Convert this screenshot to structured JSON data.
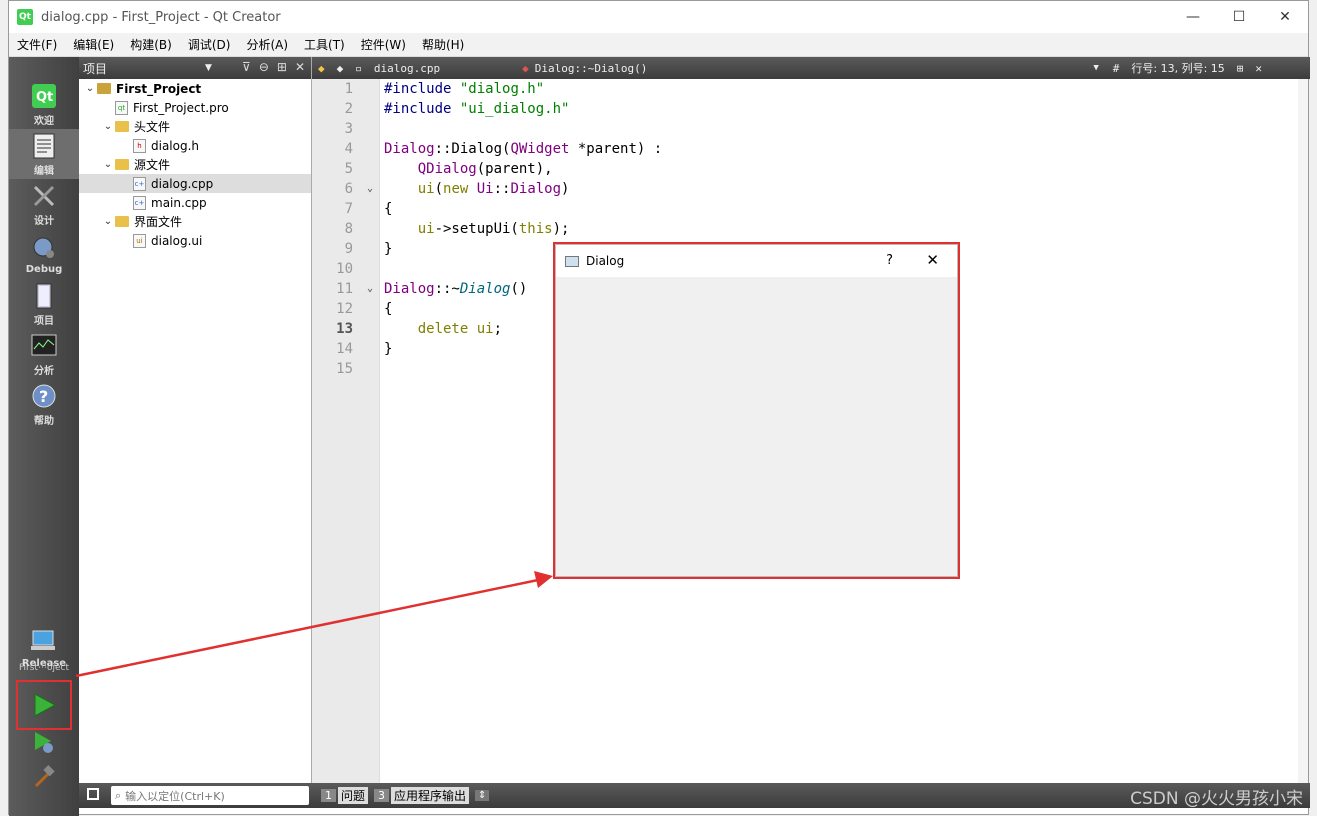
{
  "window": {
    "title": "dialog.cpp - First_Project - Qt Creator",
    "controls": [
      "minimize",
      "maximize",
      "close"
    ]
  },
  "menu": [
    "文件(F)",
    "编辑(E)",
    "构建(B)",
    "调试(D)",
    "分析(A)",
    "工具(T)",
    "控件(W)",
    "帮助(H)"
  ],
  "modes": [
    {
      "label": "欢迎",
      "icon": "qt-logo-icon",
      "active": false
    },
    {
      "label": "编辑",
      "icon": "edit-icon",
      "active": true
    },
    {
      "label": "设计",
      "icon": "design-icon",
      "active": false
    },
    {
      "label": "Debug",
      "icon": "debug-icon",
      "active": false
    },
    {
      "label": "项目",
      "icon": "projects-icon",
      "active": false
    },
    {
      "label": "分析",
      "icon": "analyze-icon",
      "active": false
    },
    {
      "label": "帮助",
      "icon": "help-icon",
      "active": false
    }
  ],
  "kit": {
    "project": "First⋯oject",
    "build": "Release"
  },
  "project_pane": {
    "title": "项目",
    "tree": [
      {
        "label": "First_Project",
        "depth": 0,
        "type": "project",
        "expanded": true,
        "bold": true
      },
      {
        "label": "First_Project.pro",
        "depth": 1,
        "type": "pro"
      },
      {
        "label": "头文件",
        "depth": 1,
        "type": "folder-h",
        "expanded": true
      },
      {
        "label": "dialog.h",
        "depth": 2,
        "type": "h"
      },
      {
        "label": "源文件",
        "depth": 1,
        "type": "folder-cpp",
        "expanded": true
      },
      {
        "label": "dialog.cpp",
        "depth": 2,
        "type": "cpp",
        "selected": true
      },
      {
        "label": "main.cpp",
        "depth": 2,
        "type": "cpp"
      },
      {
        "label": "界面文件",
        "depth": 1,
        "type": "folder-ui",
        "expanded": true
      },
      {
        "label": "dialog.ui",
        "depth": 2,
        "type": "ui"
      }
    ]
  },
  "editor": {
    "file": "dialog.cpp",
    "symbol": "Dialog::~Dialog()",
    "position": "行号: 13, 列号: 15",
    "current_line": 13,
    "lines": [
      "#include \"dialog.h\"",
      "#include \"ui_dialog.h\"",
      "",
      "Dialog::Dialog(QWidget *parent) :",
      "    QDialog(parent),",
      "    ui(new Ui::Dialog)",
      "{",
      "    ui->setupUi(this);",
      "}",
      "",
      "Dialog::~Dialog()",
      "{",
      "    delete ui;",
      "}",
      ""
    ]
  },
  "statusbar": {
    "locate_placeholder": "输入以定位(Ctrl+K)",
    "tabs": [
      {
        "num": "1",
        "label": "问题"
      },
      {
        "num": "3",
        "label": "应用程序输出"
      }
    ]
  },
  "dialog": {
    "title": "Dialog",
    "help": "?",
    "close": "✕"
  },
  "watermark": "CSDN @火火男孩小宋",
  "colors": {
    "highlight": "#e03030"
  }
}
